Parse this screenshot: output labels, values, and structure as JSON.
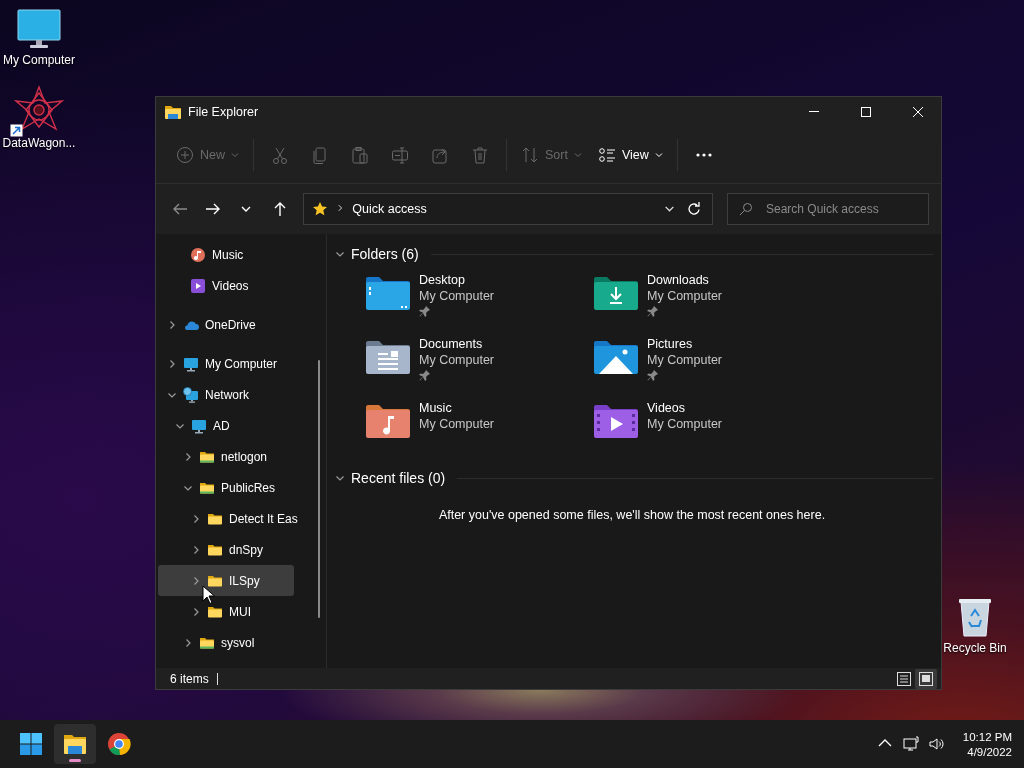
{
  "desktop_icons": [
    {
      "label": "My Computer",
      "kind": "computer",
      "shortcut": false
    },
    {
      "label": "DataWagon...",
      "kind": "star-logo",
      "shortcut": true
    }
  ],
  "recycle_bin": {
    "label": "Recycle Bin"
  },
  "window": {
    "title": "File Explorer",
    "toolbar": [
      {
        "kind": "new",
        "label": "New",
        "disabled": true
      },
      {
        "kind": "separator"
      },
      {
        "kind": "cut",
        "disabled": true
      },
      {
        "kind": "copy",
        "disabled": true
      },
      {
        "kind": "paste",
        "disabled": true
      },
      {
        "kind": "rename",
        "disabled": true
      },
      {
        "kind": "share",
        "disabled": true
      },
      {
        "kind": "delete",
        "disabled": true
      },
      {
        "kind": "separator"
      },
      {
        "kind": "sort",
        "label": "Sort",
        "disabled": true
      },
      {
        "kind": "view",
        "label": "View",
        "disabled": false
      },
      {
        "kind": "separator"
      },
      {
        "kind": "more",
        "disabled": false
      }
    ],
    "nav": [
      {
        "kind": "back",
        "disabled": true
      },
      {
        "kind": "forward",
        "disabled": false
      },
      {
        "kind": "recent",
        "disabled": false
      },
      {
        "kind": "up",
        "disabled": false
      }
    ],
    "address": {
      "path": "Quick access"
    },
    "search": {
      "placeholder": "Search Quick access"
    },
    "sidebar": {
      "pinned_children": [
        {
          "label": "Music",
          "kind": "music",
          "selected": false
        },
        {
          "label": "Videos",
          "kind": "videos",
          "selected": false
        }
      ],
      "items": [
        {
          "label": "OneDrive",
          "kind": "onedrive",
          "expanded": false,
          "selected": false
        },
        {
          "label": "My Computer",
          "kind": "computer",
          "expanded": false,
          "selected": false
        },
        {
          "label": "Network",
          "kind": "network",
          "expanded": true,
          "selected": false,
          "children": [
            {
              "label": "AD",
              "kind": "computer",
              "expanded": true,
              "selected": false,
              "children": [
                {
                  "label": "netlogon",
                  "kind": "share-folder",
                  "expanded": false,
                  "selected": false
                },
                {
                  "label": "PublicRes",
                  "kind": "share-folder",
                  "expanded": true,
                  "selected": false,
                  "children": [
                    {
                      "label": "Detect It Eas",
                      "kind": "folder",
                      "expanded": false,
                      "selected": false
                    },
                    {
                      "label": "dnSpy",
                      "kind": "folder",
                      "expanded": false,
                      "selected": false
                    },
                    {
                      "label": "ILSpy",
                      "kind": "folder",
                      "expanded": false,
                      "selected": true
                    },
                    {
                      "label": "MUI",
                      "kind": "folder",
                      "expanded": false,
                      "selected": false
                    }
                  ]
                },
                {
                  "label": "sysvol",
                  "kind": "share-folder",
                  "expanded": false,
                  "selected": false
                }
              ]
            }
          ]
        }
      ]
    },
    "sections": [
      {
        "title": "Folders (6)",
        "expanded": true,
        "folders": [
          {
            "name": "Desktop",
            "location": "My Computer",
            "kind": "desktop",
            "pinned": true
          },
          {
            "name": "Downloads",
            "location": "My Computer",
            "kind": "downloads",
            "pinned": true
          },
          {
            "name": "Documents",
            "location": "My Computer",
            "kind": "documents",
            "pinned": true
          },
          {
            "name": "Pictures",
            "location": "My Computer",
            "kind": "pictures",
            "pinned": true
          },
          {
            "name": "Music",
            "location": "My Computer",
            "kind": "music",
            "pinned": false
          },
          {
            "name": "Videos",
            "location": "My Computer",
            "kind": "videos",
            "pinned": false
          }
        ]
      },
      {
        "title": "Recent files (0)",
        "expanded": true,
        "message": "After you've opened some files, we'll show the most recent ones here."
      }
    ],
    "status": {
      "count": "6 items",
      "views": [
        {
          "kind": "details",
          "selected": false
        },
        {
          "kind": "large-icons",
          "selected": true
        }
      ]
    }
  },
  "taskbar": {
    "apps": [
      {
        "kind": "start",
        "active": false
      },
      {
        "kind": "file-explorer",
        "active": true
      },
      {
        "kind": "chrome",
        "active": false
      }
    ],
    "tray": [
      {
        "kind": "chevron"
      },
      {
        "kind": "network"
      },
      {
        "kind": "volume"
      }
    ],
    "time": "10:12 PM",
    "date": "4/9/2022"
  }
}
